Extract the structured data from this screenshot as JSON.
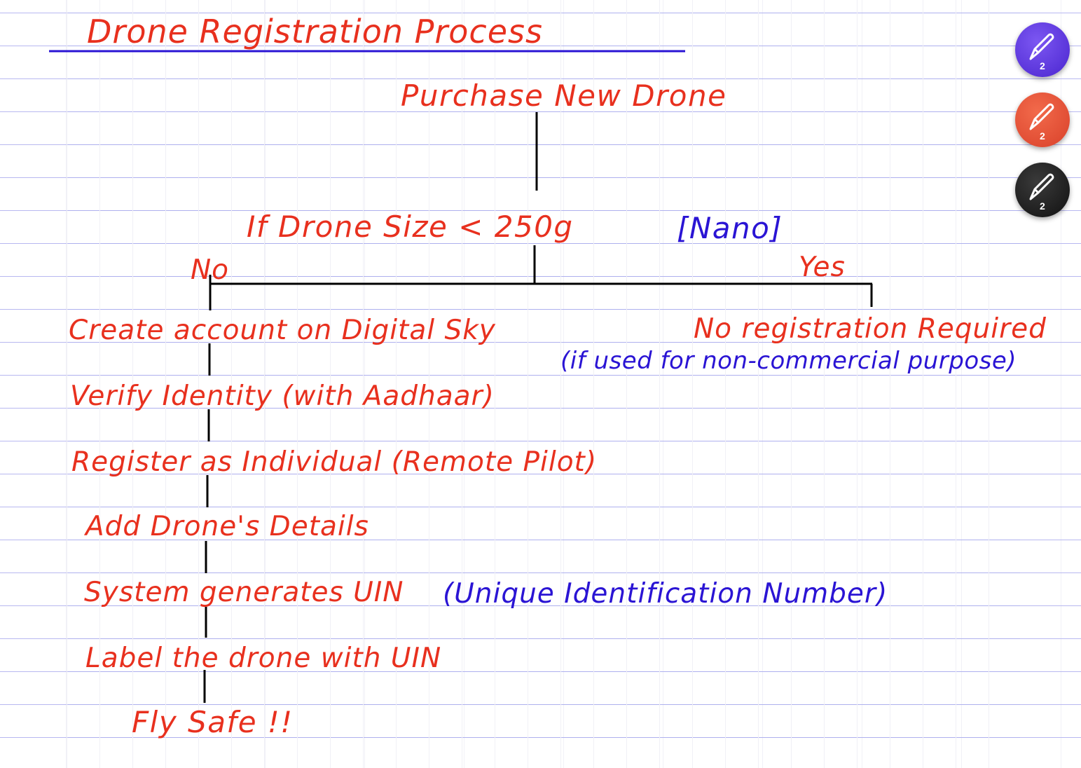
{
  "title": "Drone Registration Process",
  "root": "Purchase New Drone",
  "decision": {
    "condition": "If Drone Size < 250g",
    "tag": "[Nano]",
    "no_label": "No",
    "yes_label": "Yes"
  },
  "yes_branch": {
    "result": "No registration Required",
    "note": "(if used for non-commercial purpose)"
  },
  "no_branch_steps": [
    "Create account on Digital Sky",
    "Verify Identity (with Aadhaar)",
    "Register as Individual (Remote Pilot)",
    "Add Drone's Details",
    "System generates UIN",
    "Label the drone with UIN",
    "Fly Safe !!"
  ],
  "uin_expansion": "(Unique Identification Number)",
  "pen_tools": [
    {
      "name": "purple-pen",
      "color": "#5b33e0",
      "badge": "2",
      "icon": "pen-nib-icon"
    },
    {
      "name": "red-pen",
      "color": "#e94b2c",
      "badge": "2",
      "icon": "pen-nib-icon"
    },
    {
      "name": "black-pen",
      "color": "#1e1e1e",
      "badge": "2",
      "icon": "pen-nib-icon"
    }
  ],
  "colors": {
    "red_ink": "#e8301e",
    "blue_ink": "#2a14d4",
    "title_underline": "#2a14d4",
    "connector": "#000000",
    "rule_line": "#aeb0ee"
  }
}
